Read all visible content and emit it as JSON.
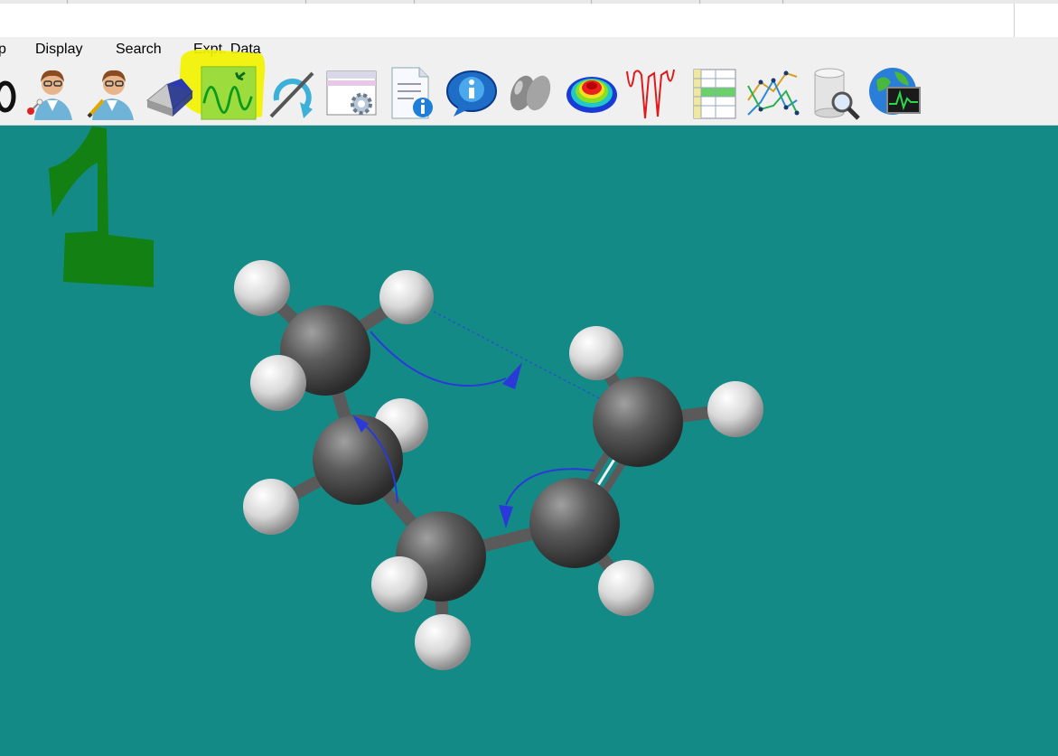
{
  "menu": {
    "items": [
      {
        "label": "p"
      },
      {
        "label": "Display"
      },
      {
        "label": "Search"
      },
      {
        "label": "Expt. Data"
      }
    ]
  },
  "toolbar": {
    "tools": [
      {
        "icon": "lasso-icon"
      },
      {
        "icon": "person-molecule-icon"
      },
      {
        "icon": "person-edit-icon"
      },
      {
        "icon": "eraser-icon"
      },
      {
        "icon": "vibration-wave-icon",
        "highlighted": true
      },
      {
        "icon": "rotate-refresh-icon"
      },
      {
        "icon": "settings-window-icon"
      },
      {
        "icon": "document-info-icon"
      },
      {
        "icon": "info-bubble-icon"
      },
      {
        "icon": "orbital-icon"
      },
      {
        "icon": "surface-map-icon"
      },
      {
        "icon": "spectrum-icon"
      },
      {
        "icon": "table-icon"
      },
      {
        "icon": "line-graph-icon"
      },
      {
        "icon": "database-search-icon"
      },
      {
        "icon": "globe-monitor-icon"
      }
    ]
  },
  "annotation": {
    "label": "1",
    "color": "#128012",
    "highlight": "#f2f200"
  },
  "viewer": {
    "background": "#148a87",
    "atom_colors": {
      "carbon": "#545454",
      "hydrogen": "#e4e4e4"
    },
    "vector_color": "#2a3ad8"
  }
}
